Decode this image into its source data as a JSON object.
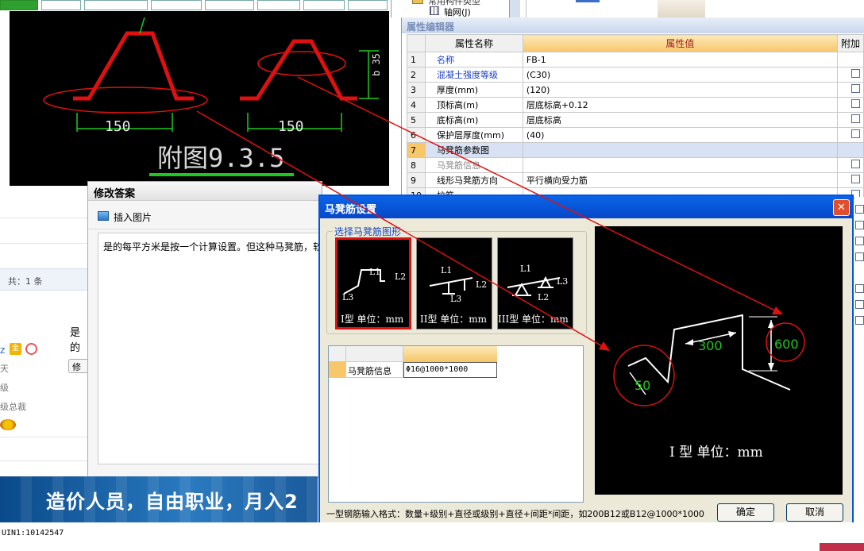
{
  "colors": {
    "cad_bg": "#000000",
    "red": "#e01010",
    "xp_blue": "#0054e3",
    "selected_row": "#d8e2f4"
  },
  "forum": {
    "total_count": "共：1 条",
    "answer_prefix": "是的",
    "user_suffix": "z",
    "badge": "金",
    "edit_fragment": "修",
    "line_a": "天",
    "line_b": "级",
    "line_c": "级总裁"
  },
  "cad_image": {
    "caption": "附图9.3.5",
    "dim_left": "150",
    "dim_right": "150",
    "dim_side": "b 35"
  },
  "tree": {
    "item_axis": "轴网(J)",
    "item_partial": "常用构件类型"
  },
  "property_editor": {
    "title": "属性编辑器",
    "col_name": "属性名称",
    "col_value": "属性值",
    "col_extra": "附加",
    "rows": [
      {
        "num": "1",
        "name": "名称",
        "value": "FB-1",
        "blue": true
      },
      {
        "num": "2",
        "name": "混凝土强度等级",
        "value": "(C30)",
        "blue": true
      },
      {
        "num": "3",
        "name": "厚度(mm)",
        "value": "(120)",
        "blue": false
      },
      {
        "num": "4",
        "name": "顶标高(m)",
        "value": "层底标高+0.12",
        "blue": false
      },
      {
        "num": "5",
        "name": "底标高(m)",
        "value": "层底标高",
        "blue": false
      },
      {
        "num": "6",
        "name": "保护层厚度(mm)",
        "value": "(40)",
        "blue": false
      },
      {
        "num": "7",
        "name": "马凳筋参数图",
        "value": "",
        "blue": false,
        "selected": true
      },
      {
        "num": "8",
        "name": "马凳筋信息",
        "value": "",
        "blue": false,
        "gray": true
      },
      {
        "num": "9",
        "name": "线形马凳筋方向",
        "value": "平行横向受力筋",
        "blue": false
      },
      {
        "num": "10",
        "name": "拉筋",
        "value": "",
        "blue": false
      }
    ]
  },
  "modify_answer": {
    "title": "修改答案",
    "insert_image": "插入图片",
    "body_text": "是的每平方米是按一个计算设置。但这种马凳筋，软"
  },
  "mabeng_dialog": {
    "title": "马凳筋设置",
    "group_label": "选择马凳筋图形",
    "thumbs": [
      {
        "caption": "I型 单位：mm",
        "labels": [
          "L1",
          "L2",
          "L3"
        ]
      },
      {
        "caption": "II型 单位：mm",
        "labels": [
          "L1",
          "L2",
          "L3"
        ]
      },
      {
        "caption": "III型 单位：mm",
        "labels": [
          "L1",
          "L3",
          "L2"
        ]
      }
    ],
    "grid": {
      "row_label": "马凳筋信息",
      "row_value": "Φ16@1000*1000"
    },
    "preview": {
      "caption": "I 型  单位：mm",
      "dim_300": "300",
      "dim_600": "600",
      "dim_50": "50"
    },
    "hint": "一型钢筋输入格式：数量+级别+直径或级别+直径+间距*间距，如200B12或B12@1000*1000",
    "ok_label": "确定",
    "cancel_label": "取消"
  },
  "banner": {
    "text": "造价人员，自由职业，月入2"
  },
  "uin": "UIN1:10142547"
}
